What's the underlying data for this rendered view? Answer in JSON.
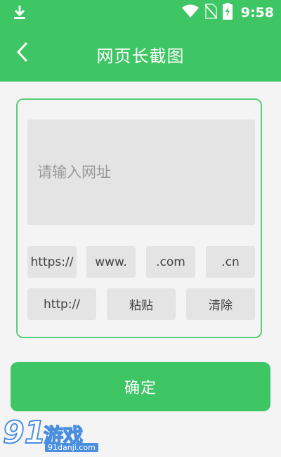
{
  "status_bar": {
    "time": "9:58",
    "icons": [
      "download-icon",
      "wifi-icon",
      "no-sim-icon",
      "battery-charging-icon"
    ]
  },
  "app_bar": {
    "title": "网页长截图",
    "back_icon": "chevron-left-icon"
  },
  "url_input": {
    "placeholder": "请输入网址",
    "value": ""
  },
  "shortcuts_row1": [
    "https://",
    "www.",
    ".com",
    ".cn"
  ],
  "actions_row2": {
    "http": "http://",
    "paste": "粘贴",
    "clear": "清除"
  },
  "confirm_label": "确定",
  "watermark": {
    "number": "91",
    "name": "游戏",
    "url": "91danji.com"
  },
  "colors": {
    "accent": "#3ec564",
    "card_border": "#5ccd7a",
    "chip_bg": "#e4e4e4",
    "background": "#f4f4f4"
  }
}
